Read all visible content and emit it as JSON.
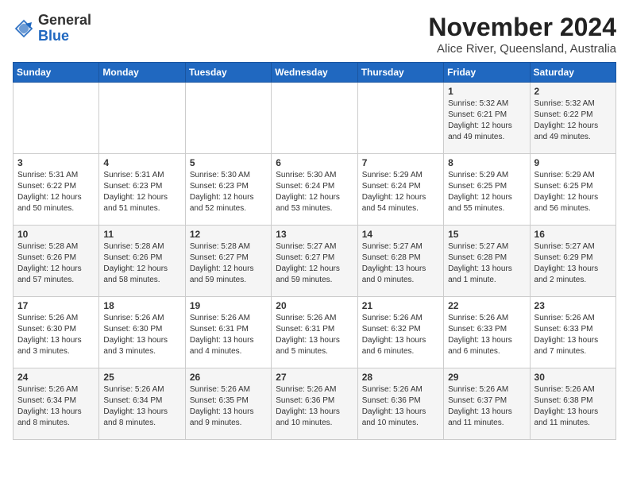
{
  "app": {
    "name_general": "General",
    "name_blue": "Blue"
  },
  "header": {
    "month": "November 2024",
    "location": "Alice River, Queensland, Australia"
  },
  "days_of_week": [
    "Sunday",
    "Monday",
    "Tuesday",
    "Wednesday",
    "Thursday",
    "Friday",
    "Saturday"
  ],
  "weeks": [
    [
      {
        "day": "",
        "info": ""
      },
      {
        "day": "",
        "info": ""
      },
      {
        "day": "",
        "info": ""
      },
      {
        "day": "",
        "info": ""
      },
      {
        "day": "",
        "info": ""
      },
      {
        "day": "1",
        "info": "Sunrise: 5:32 AM\nSunset: 6:21 PM\nDaylight: 12 hours and 49 minutes."
      },
      {
        "day": "2",
        "info": "Sunrise: 5:32 AM\nSunset: 6:22 PM\nDaylight: 12 hours and 49 minutes."
      }
    ],
    [
      {
        "day": "3",
        "info": "Sunrise: 5:31 AM\nSunset: 6:22 PM\nDaylight: 12 hours and 50 minutes."
      },
      {
        "day": "4",
        "info": "Sunrise: 5:31 AM\nSunset: 6:23 PM\nDaylight: 12 hours and 51 minutes."
      },
      {
        "day": "5",
        "info": "Sunrise: 5:30 AM\nSunset: 6:23 PM\nDaylight: 12 hours and 52 minutes."
      },
      {
        "day": "6",
        "info": "Sunrise: 5:30 AM\nSunset: 6:24 PM\nDaylight: 12 hours and 53 minutes."
      },
      {
        "day": "7",
        "info": "Sunrise: 5:29 AM\nSunset: 6:24 PM\nDaylight: 12 hours and 54 minutes."
      },
      {
        "day": "8",
        "info": "Sunrise: 5:29 AM\nSunset: 6:25 PM\nDaylight: 12 hours and 55 minutes."
      },
      {
        "day": "9",
        "info": "Sunrise: 5:29 AM\nSunset: 6:25 PM\nDaylight: 12 hours and 56 minutes."
      }
    ],
    [
      {
        "day": "10",
        "info": "Sunrise: 5:28 AM\nSunset: 6:26 PM\nDaylight: 12 hours and 57 minutes."
      },
      {
        "day": "11",
        "info": "Sunrise: 5:28 AM\nSunset: 6:26 PM\nDaylight: 12 hours and 58 minutes."
      },
      {
        "day": "12",
        "info": "Sunrise: 5:28 AM\nSunset: 6:27 PM\nDaylight: 12 hours and 59 minutes."
      },
      {
        "day": "13",
        "info": "Sunrise: 5:27 AM\nSunset: 6:27 PM\nDaylight: 12 hours and 59 minutes."
      },
      {
        "day": "14",
        "info": "Sunrise: 5:27 AM\nSunset: 6:28 PM\nDaylight: 13 hours and 0 minutes."
      },
      {
        "day": "15",
        "info": "Sunrise: 5:27 AM\nSunset: 6:28 PM\nDaylight: 13 hours and 1 minute."
      },
      {
        "day": "16",
        "info": "Sunrise: 5:27 AM\nSunset: 6:29 PM\nDaylight: 13 hours and 2 minutes."
      }
    ],
    [
      {
        "day": "17",
        "info": "Sunrise: 5:26 AM\nSunset: 6:30 PM\nDaylight: 13 hours and 3 minutes."
      },
      {
        "day": "18",
        "info": "Sunrise: 5:26 AM\nSunset: 6:30 PM\nDaylight: 13 hours and 3 minutes."
      },
      {
        "day": "19",
        "info": "Sunrise: 5:26 AM\nSunset: 6:31 PM\nDaylight: 13 hours and 4 minutes."
      },
      {
        "day": "20",
        "info": "Sunrise: 5:26 AM\nSunset: 6:31 PM\nDaylight: 13 hours and 5 minutes."
      },
      {
        "day": "21",
        "info": "Sunrise: 5:26 AM\nSunset: 6:32 PM\nDaylight: 13 hours and 6 minutes."
      },
      {
        "day": "22",
        "info": "Sunrise: 5:26 AM\nSunset: 6:33 PM\nDaylight: 13 hours and 6 minutes."
      },
      {
        "day": "23",
        "info": "Sunrise: 5:26 AM\nSunset: 6:33 PM\nDaylight: 13 hours and 7 minutes."
      }
    ],
    [
      {
        "day": "24",
        "info": "Sunrise: 5:26 AM\nSunset: 6:34 PM\nDaylight: 13 hours and 8 minutes."
      },
      {
        "day": "25",
        "info": "Sunrise: 5:26 AM\nSunset: 6:34 PM\nDaylight: 13 hours and 8 minutes."
      },
      {
        "day": "26",
        "info": "Sunrise: 5:26 AM\nSunset: 6:35 PM\nDaylight: 13 hours and 9 minutes."
      },
      {
        "day": "27",
        "info": "Sunrise: 5:26 AM\nSunset: 6:36 PM\nDaylight: 13 hours and 10 minutes."
      },
      {
        "day": "28",
        "info": "Sunrise: 5:26 AM\nSunset: 6:36 PM\nDaylight: 13 hours and 10 minutes."
      },
      {
        "day": "29",
        "info": "Sunrise: 5:26 AM\nSunset: 6:37 PM\nDaylight: 13 hours and 11 minutes."
      },
      {
        "day": "30",
        "info": "Sunrise: 5:26 AM\nSunset: 6:38 PM\nDaylight: 13 hours and 11 minutes."
      }
    ]
  ]
}
